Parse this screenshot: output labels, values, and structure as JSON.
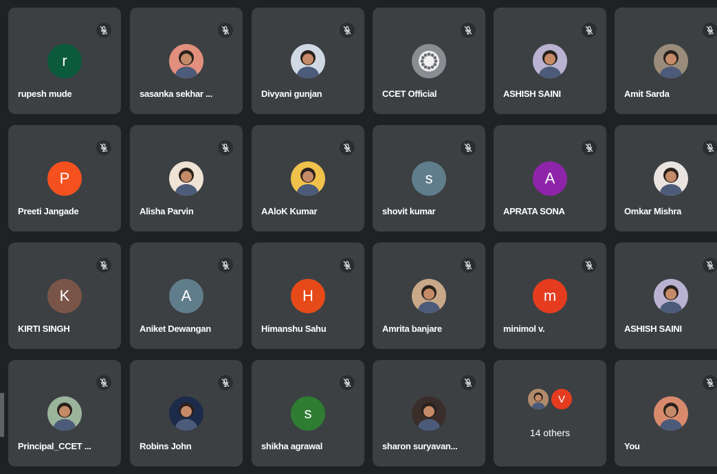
{
  "colors": {
    "background": "#202124",
    "tile": "#3c4043",
    "name_text": "#ffffff",
    "muted_mic_icon": "#e8eaed"
  },
  "participants": [
    {
      "name": "rupesh mude",
      "initial": "r",
      "avatar_color": "#0b5a3c",
      "avatar_type": "letter",
      "muted": true
    },
    {
      "name": "sasanka sekhar ...",
      "initial": "",
      "avatar_color": "#e28f7d",
      "avatar_type": "photo",
      "muted": true
    },
    {
      "name": "Divyani gunjan",
      "initial": "",
      "avatar_color": "#cfd8e3",
      "avatar_type": "photo",
      "muted": true
    },
    {
      "name": "CCET Official",
      "initial": "",
      "avatar_color": "#8a8d92",
      "avatar_type": "logo",
      "muted": true
    },
    {
      "name": "ASHISH SAINI",
      "initial": "",
      "avatar_color": "#b9b2d0",
      "avatar_type": "photo",
      "muted": true
    },
    {
      "name": "Amit Sarda",
      "initial": "",
      "avatar_color": "#9a8c7a",
      "avatar_type": "photo",
      "muted": true
    },
    {
      "name": "Preeti Jangade",
      "initial": "P",
      "avatar_color": "#f4511e",
      "avatar_type": "letter",
      "muted": true
    },
    {
      "name": "Alisha Parvin",
      "initial": "",
      "avatar_color": "#efe3d5",
      "avatar_type": "photo",
      "muted": true
    },
    {
      "name": "AAloK Kumar",
      "initial": "",
      "avatar_color": "#f0c24b",
      "avatar_type": "photo",
      "muted": true
    },
    {
      "name": "shovit kumar",
      "initial": "s",
      "avatar_color": "#607d8b",
      "avatar_type": "letter",
      "muted": true
    },
    {
      "name": "APRATA SONA",
      "initial": "A",
      "avatar_color": "#8e24aa",
      "avatar_type": "letter",
      "muted": true
    },
    {
      "name": "Omkar Mishra",
      "initial": "",
      "avatar_color": "#e9e4df",
      "avatar_type": "photo",
      "muted": true
    },
    {
      "name": "KIRTI SINGH",
      "initial": "K",
      "avatar_color": "#795548",
      "avatar_type": "letter",
      "muted": true
    },
    {
      "name": "Aniket Dewangan",
      "initial": "A",
      "avatar_color": "#607d8b",
      "avatar_type": "letter",
      "muted": true
    },
    {
      "name": "Himanshu Sahu",
      "initial": "H",
      "avatar_color": "#e64a19",
      "avatar_type": "letter",
      "muted": true
    },
    {
      "name": "Amrita banjare",
      "initial": "",
      "avatar_color": "#c9a88a",
      "avatar_type": "photo",
      "muted": true
    },
    {
      "name": "minimol v.",
      "initial": "m",
      "avatar_color": "#e53c1f",
      "avatar_type": "letter",
      "muted": true
    },
    {
      "name": "ASHISH SAINI",
      "initial": "",
      "avatar_color": "#b9b2d0",
      "avatar_type": "photo",
      "muted": true
    },
    {
      "name": "Principal_CCET ...",
      "initial": "",
      "avatar_color": "#9bb59c",
      "avatar_type": "photo",
      "muted": true
    },
    {
      "name": "Robins John",
      "initial": "",
      "avatar_color": "#1d2b4a",
      "avatar_type": "photo",
      "muted": true
    },
    {
      "name": "shikha agrawal",
      "initial": "s",
      "avatar_color": "#2e7d32",
      "avatar_type": "letter",
      "muted": true
    },
    {
      "name": "sharon suryavan...",
      "initial": "",
      "avatar_color": "#3a2e2b",
      "avatar_type": "photo",
      "muted": true
    },
    {
      "name": "",
      "initial": "",
      "avatar_color": "",
      "avatar_type": "others",
      "muted": false
    },
    {
      "name": "You",
      "initial": "",
      "avatar_color": "#d98a6d",
      "avatar_type": "photo",
      "muted": true
    }
  ],
  "others_tile": {
    "label": "14 others",
    "mini_initial": "V",
    "mini_color": "#e53c1f"
  }
}
